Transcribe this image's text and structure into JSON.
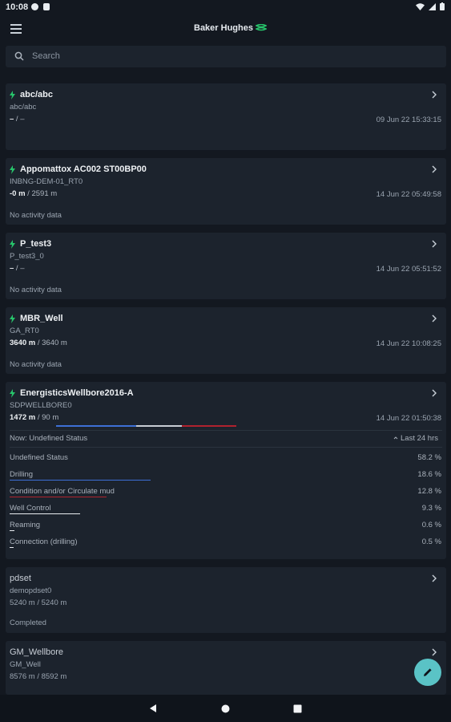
{
  "status_bar": {
    "time": "10:08"
  },
  "header": {
    "brand": "Baker Hughes"
  },
  "search": {
    "placeholder": "Search"
  },
  "colors": {
    "accent_green": "#27c46b",
    "fab": "#5ac3c6",
    "drilling_blue": "#3d6fd6",
    "condition_red": "#b0222e",
    "well_control_white": "#e8ecf0"
  },
  "wells": [
    {
      "name": "abc/abc",
      "wellbore": "abc/abc",
      "depth_current": "–",
      "depth_total": " / –",
      "timestamp": "09 Jun 22 15:33:15"
    },
    {
      "name": "Appomattox AC002 ST00BP00",
      "wellbore": "INBNG-DEM-01_RT0",
      "depth_current": "-0 m",
      "depth_total": " / 2591 m",
      "timestamp": "14 Jun 22 05:49:58",
      "activity": "No activity data"
    },
    {
      "name": "P_test3",
      "wellbore": "P_test3_0",
      "depth_current": "–",
      "depth_total": " / –",
      "timestamp": "14 Jun 22 05:51:52",
      "activity": "No activity data"
    },
    {
      "name": "MBR_Well",
      "wellbore": "GA_RT0",
      "depth_current": "3640 m",
      "depth_total": " / 3640 m",
      "timestamp": "14 Jun 22 10:08:25",
      "activity": "No activity data"
    },
    {
      "name": "EnergisticsWellbore2016-A",
      "wellbore": "SDPWELLBORE0",
      "depth_current": "1472 m",
      "depth_total": " / 90 m",
      "timestamp": "14 Jun 22 01:50:38",
      "now_status": "Now: Undefined Status",
      "period": "Last 24 hrs",
      "activity_breakdown": [
        {
          "label": "Undefined Status",
          "percent": "58.2 %"
        },
        {
          "label": "Drilling",
          "percent": "18.6 %"
        },
        {
          "label": "Condition and/or Circulate mud",
          "percent": "12.8 %"
        },
        {
          "label": "Well Control",
          "percent": "9.3 %"
        },
        {
          "label": "Reaming",
          "percent": "0.6 %"
        },
        {
          "label": "Connection (drilling)",
          "percent": "0.5 %"
        }
      ]
    },
    {
      "name": "pdset",
      "wellbore": "demopdset0",
      "depth_text": "5240 m / 5240 m",
      "activity": "Completed"
    },
    {
      "name": "GM_Wellbore",
      "wellbore": "GM_Well",
      "depth_text": "8576 m / 8592 m"
    }
  ]
}
